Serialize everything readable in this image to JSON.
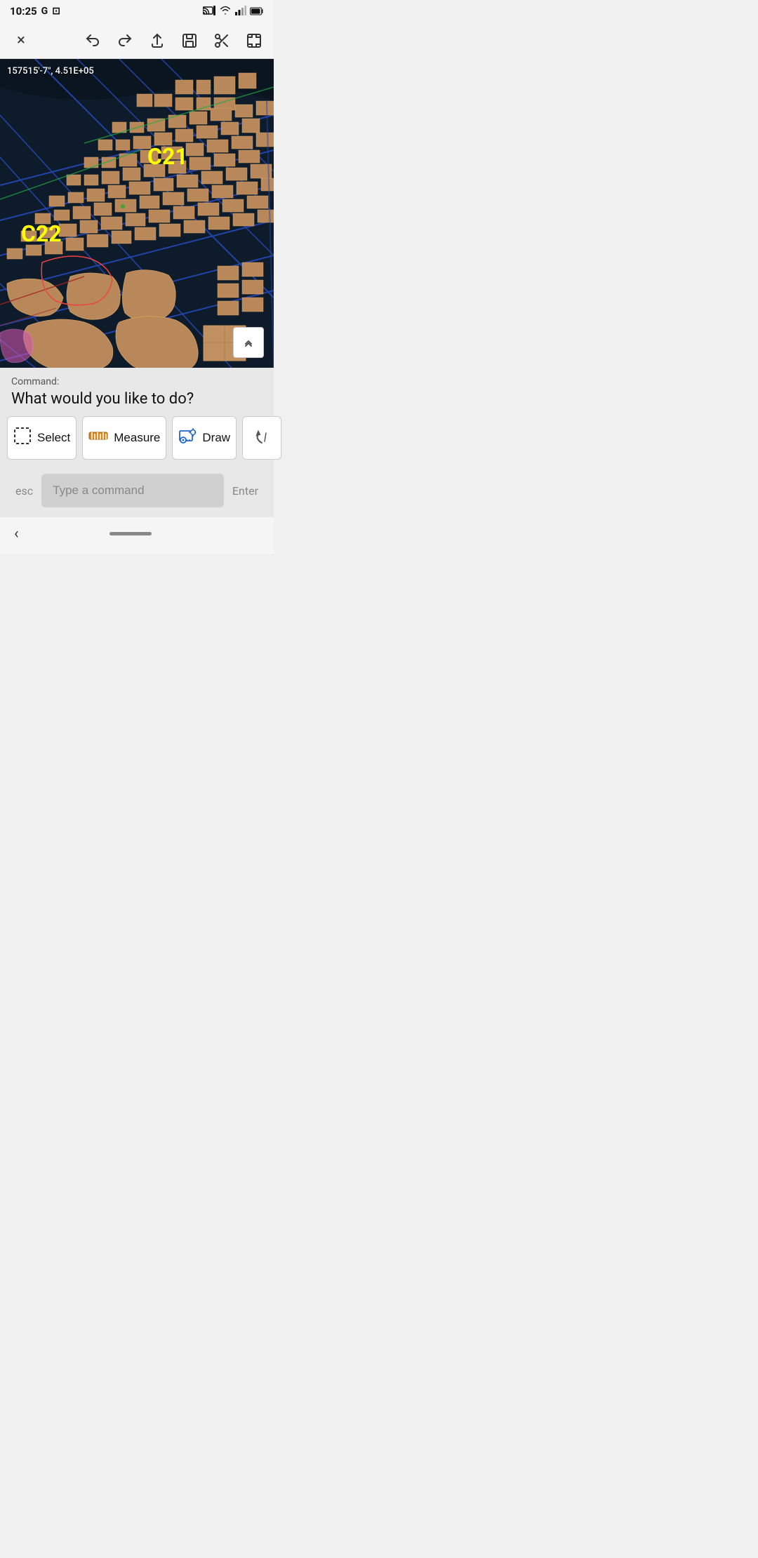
{
  "statusBar": {
    "time": "10:25",
    "icons": {
      "google": "G",
      "screen_record": "⊡",
      "cast": "📡",
      "wifi": "WiFi",
      "signal": "Signal",
      "battery": "Battery"
    }
  },
  "toolbar": {
    "close_label": "×",
    "undo_label": "↩",
    "redo_label": "↪",
    "share_label": "↑",
    "save_label": "💾",
    "scissors_label": "✂",
    "expand_label": "⤢"
  },
  "map": {
    "coords": "157515'-7\", 4.51E+05",
    "label_c21": "C21",
    "label_c22": "C22"
  },
  "commandPanel": {
    "command_prefix": "Command:",
    "prompt": "What would you like to do?",
    "buttons": {
      "select": "Select",
      "measure": "Measure",
      "draw": "Draw",
      "more": "…"
    },
    "input_placeholder": "Type a command",
    "esc_label": "esc",
    "enter_label": "Enter"
  },
  "bottomNav": {
    "back_label": "‹"
  }
}
